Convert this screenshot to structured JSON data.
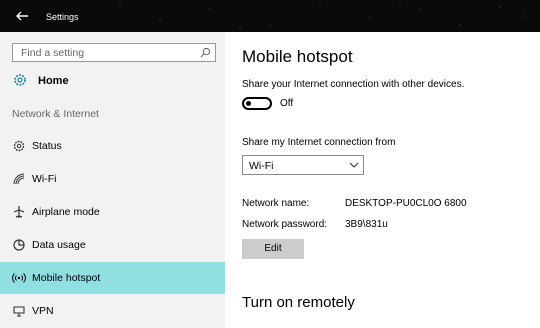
{
  "window": {
    "title": "Settings"
  },
  "sidebar": {
    "search_placeholder": "Find a setting",
    "home_label": "Home",
    "section_title": "Network & Internet",
    "items": [
      {
        "label": "Status",
        "icon": "gear-icon"
      },
      {
        "label": "Wi-Fi",
        "icon": "wifi-icon"
      },
      {
        "label": "Airplane mode",
        "icon": "airplane-icon"
      },
      {
        "label": "Data usage",
        "icon": "data-usage-icon"
      },
      {
        "label": "Mobile hotspot",
        "icon": "hotspot-icon",
        "selected": true
      },
      {
        "label": "VPN",
        "icon": "vpn-icon"
      }
    ]
  },
  "main": {
    "title": "Mobile hotspot",
    "share_description": "Share your Internet connection with other devices.",
    "toggle_state": "Off",
    "share_from_label": "Share my Internet connection from",
    "share_from_value": "Wi-Fi",
    "network_name_label": "Network name:",
    "network_name_value": "DESKTOP-PU0CL0O 6800",
    "network_password_label": "Network password:",
    "network_password_value": "3B9\\831u",
    "edit_button": "Edit",
    "remote_title": "Turn on remotely"
  },
  "colors": {
    "selected_item": "#8fdfe3",
    "sidebar_bg": "#f2f2f2"
  }
}
